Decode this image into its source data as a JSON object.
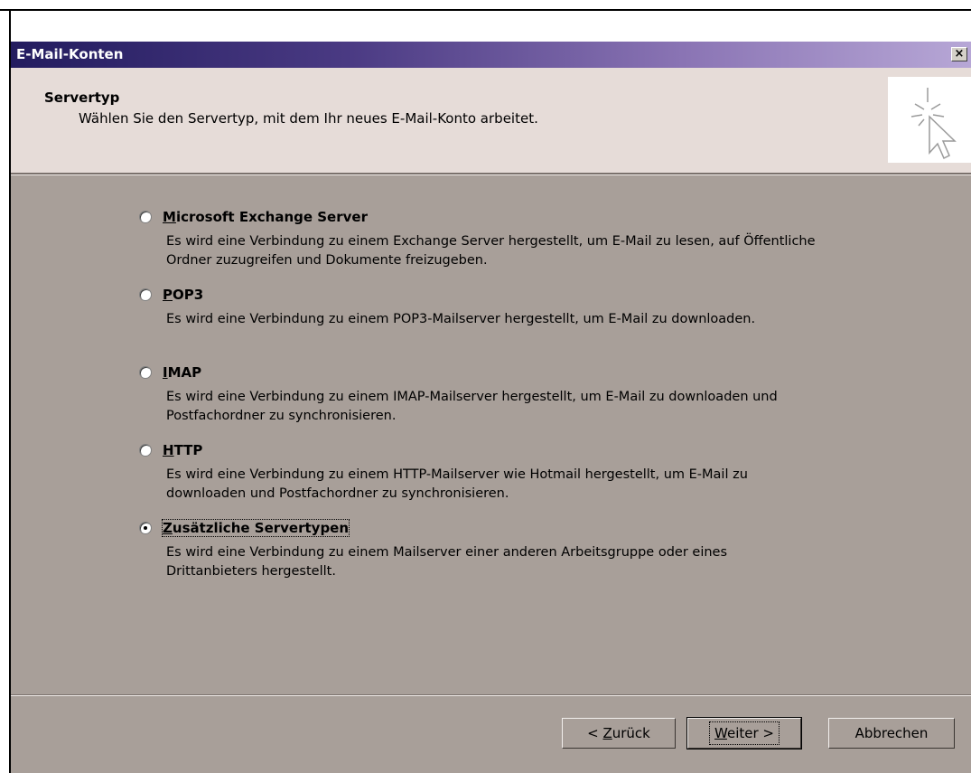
{
  "window": {
    "title": "E-Mail-Konten",
    "close_label": "×"
  },
  "header": {
    "title": "Servertyp",
    "subtitle": "Wählen Sie den Servertyp, mit dem Ihr neues E-Mail-Konto arbeitet.",
    "icon": "wizard-cursor-icon"
  },
  "options": [
    {
      "label": "Microsoft Exchange Server",
      "mnemonic": "M",
      "rest": "icrosoft Exchange Server",
      "checked": false,
      "description": "Es wird eine Verbindung zu einem Exchange Server hergestellt, um E-Mail zu lesen, auf Öffentliche Ordner zuzugreifen und Dokumente freizugeben."
    },
    {
      "label": "POP3",
      "mnemonic": "P",
      "rest": "OP3",
      "checked": false,
      "description": "Es wird eine Verbindung zu einem POP3-Mailserver hergestellt, um E-Mail zu downloaden."
    },
    {
      "label": "IMAP",
      "mnemonic": "I",
      "rest": "MAP",
      "checked": false,
      "description": "Es wird eine Verbindung zu einem IMAP-Mailserver hergestellt, um E-Mail zu downloaden und Postfachordner zu synchronisieren."
    },
    {
      "label": "HTTP",
      "mnemonic": "H",
      "rest": "TTP",
      "checked": false,
      "description": "Es wird eine Verbindung zu einem HTTP-Mailserver wie Hotmail hergestellt, um E-Mail zu downloaden und Postfachordner zu synchronisieren."
    },
    {
      "label": "Zusätzliche Servertypen",
      "mnemonic": "Z",
      "rest": "usätzliche Servertypen",
      "checked": true,
      "description": "Es wird eine Verbindung zu einem Mailserver einer anderen Arbeitsgruppe oder eines Drittanbieters hergestellt."
    }
  ],
  "buttons": {
    "back": {
      "pre": "< ",
      "mnemonic": "Z",
      "rest": "urück"
    },
    "next": {
      "pre": "",
      "mnemonic": "W",
      "rest": "eiter >"
    },
    "cancel": {
      "label": "Abbrechen"
    }
  }
}
